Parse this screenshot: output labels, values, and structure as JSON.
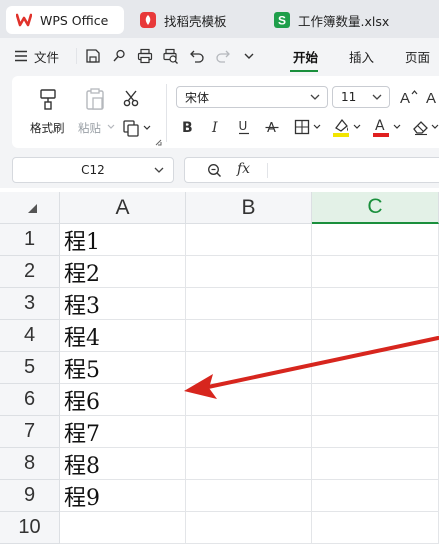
{
  "tabs": [
    {
      "label": "WPS Office",
      "active": true
    },
    {
      "label": "找稻壳模板",
      "active": false
    },
    {
      "label": "工作簿数量.xlsx",
      "active": false
    }
  ],
  "menu": {
    "file": "文件",
    "items": [
      "开始",
      "插入",
      "页面"
    ],
    "active": "开始"
  },
  "ribbon": {
    "format_painter": "格式刷",
    "paste": "粘贴",
    "font_name": "宋体",
    "font_size": "11"
  },
  "formula_bar": {
    "name_box": "C12",
    "fx": "fx",
    "value": ""
  },
  "sheet": {
    "columns": [
      "A",
      "B",
      "C"
    ],
    "selected_column": "C",
    "rows": [
      "1",
      "2",
      "3",
      "4",
      "5",
      "6",
      "7",
      "8",
      "9",
      "10"
    ],
    "values": {
      "A": [
        "程1",
        "程2",
        "程3",
        "程4",
        "程5",
        "程6",
        "程7",
        "程8",
        "程9",
        ""
      ]
    }
  },
  "colors": {
    "accent_green": "#1a8f3c",
    "wps_red": "#e0322b",
    "arrow_red": "#d7261e",
    "highlight_yellow": "#f2e500",
    "font_red": "#e02020"
  }
}
